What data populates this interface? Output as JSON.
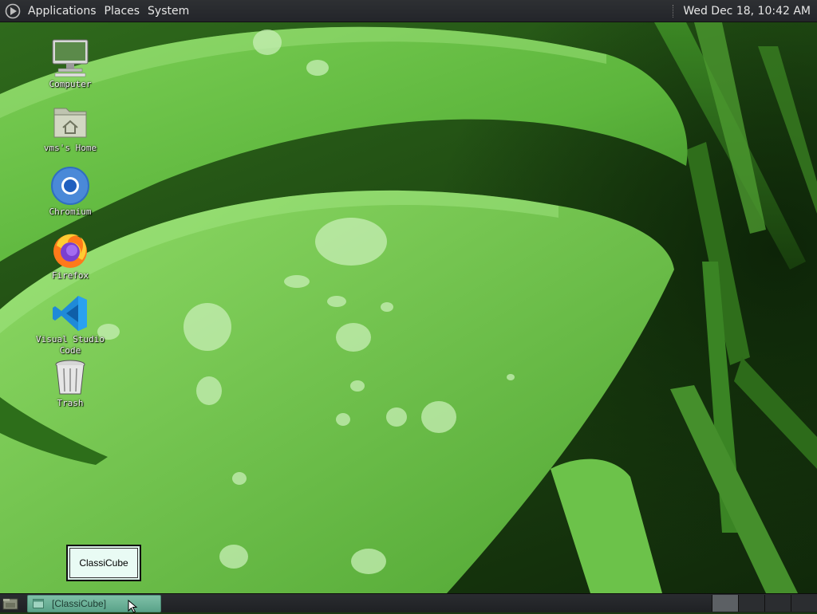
{
  "top_panel": {
    "menus": [
      "Applications",
      "Places",
      "System"
    ],
    "clock": "Wed Dec 18, 10:42 AM",
    "logo_icon": "distro-logo-icon"
  },
  "desktop_icons": [
    {
      "label": "Computer",
      "icon": "computer-icon"
    },
    {
      "label": "vms's Home",
      "icon": "home-folder-icon"
    },
    {
      "label": "Chromium",
      "icon": "chromium-icon"
    },
    {
      "label": "Firefox",
      "icon": "firefox-icon"
    },
    {
      "label": "Visual Studio Code",
      "icon": "vscode-icon"
    },
    {
      "label": "Trash",
      "icon": "trash-icon"
    }
  ],
  "floating_window": {
    "title": "ClassiCube"
  },
  "taskbar": {
    "show_desktop_icon": "show-desktop-icon",
    "tasks": [
      {
        "label": "[ClassiCube]",
        "icon": "window-icon"
      }
    ],
    "workspaces": 4,
    "active_workspace": 1
  },
  "colors": {
    "panel_bg": "#25272b",
    "task_active": "#6fb39b",
    "window_bg": "#e9fbf4"
  }
}
